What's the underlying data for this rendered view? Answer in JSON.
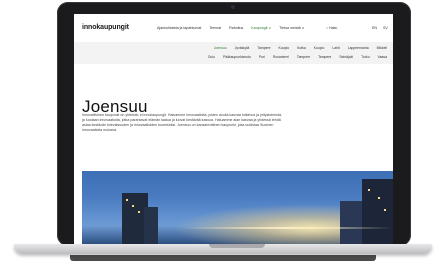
{
  "site": {
    "logo": "innokaupungit",
    "top_nav": [
      {
        "label": "Ajankohtaista ja tapahtumat",
        "active": false
      },
      {
        "label": "Teemat",
        "active": false
      },
      {
        "label": "Rahoitus",
        "active": false
      },
      {
        "label": "Kaupungit ∨",
        "active": true
      },
      {
        "label": "Tietoa meistä ∨",
        "active": false
      }
    ],
    "search_label": "⌕ Haku",
    "languages": [
      "EN",
      "SV"
    ]
  },
  "cities": {
    "row1": [
      {
        "label": "Joensuu",
        "active": true
      },
      {
        "label": "Jyväskylä",
        "active": false
      },
      {
        "label": "Tampere",
        "active": false
      },
      {
        "label": "Kuopio",
        "active": false
      },
      {
        "label": "Kotka",
        "active": false
      },
      {
        "label": "Kuopio",
        "active": false
      },
      {
        "label": "Lahti",
        "active": false
      },
      {
        "label": "Lappeenranta",
        "active": false
      },
      {
        "label": "Mikkeli",
        "active": false
      }
    ],
    "row2": [
      {
        "label": "Oulu",
        "active": false
      },
      {
        "label": "Pääkaupunkiseutu",
        "active": false
      },
      {
        "label": "Pori",
        "active": false
      },
      {
        "label": "Rovaniemi",
        "active": false
      },
      {
        "label": "Tampere",
        "active": false
      },
      {
        "label": "Tampere",
        "active": false
      },
      {
        "label": "Seinäjoki",
        "active": false
      },
      {
        "label": "Turku",
        "active": false
      },
      {
        "label": "Vaasa",
        "active": false
      }
    ]
  },
  "hero": {
    "title": "Joensuu",
    "text": "Innovatiivinen kaupunki on yhteistä; ei innokaupungit. Haluamme innovaatioita, joiden avulla kasvaa tutkimus ja yritystoiminta, ja luodaan innovaatioita, jotka parantavat elämän laatua ja luovat kestävää kasvua. Haluamme alan kasvaa ja yhdessä tehdä asiaa kestävän tulevaisuuden ja innovaatioiden tuomiseksi. Joensuu on kansainvälinen kaupunki, joka uudistaa Suomen innovaatioita mukana."
  }
}
